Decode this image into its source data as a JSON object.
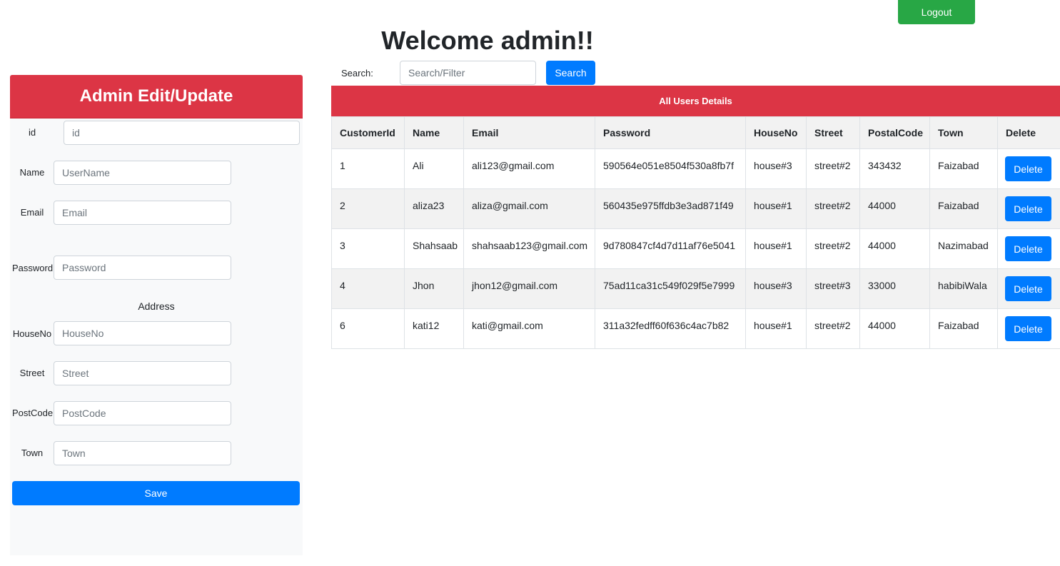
{
  "header": {
    "title": "Welcome admin!!",
    "logout_label": "Logout"
  },
  "admin_form": {
    "title": "Admin Edit/Update",
    "address_heading": "Address",
    "save_label": "Save",
    "fields": [
      {
        "label": "id",
        "placeholder": "id"
      },
      {
        "label": "Name",
        "placeholder": "UserName"
      },
      {
        "label": "Email",
        "placeholder": "Email"
      },
      {
        "label": "Password",
        "placeholder": "Password"
      },
      {
        "label": "HouseNo",
        "placeholder": "HouseNo"
      },
      {
        "label": "Street",
        "placeholder": "Street"
      },
      {
        "label": "PostCode",
        "placeholder": "PostCode"
      },
      {
        "label": "Town",
        "placeholder": "Town"
      }
    ]
  },
  "search": {
    "label": "Search:",
    "placeholder": "Search/Filter",
    "button_label": "Search"
  },
  "users_table": {
    "title": "All Users Details",
    "columns": [
      "CustomerId",
      "Name",
      "Email",
      "Password",
      "HouseNo",
      "Street",
      "PostalCode",
      "Town",
      "Delete"
    ],
    "delete_label": "Delete",
    "rows": [
      [
        "1",
        "Ali",
        "ali123@gmail.com",
        "590564e051e8504f530a8fb7f",
        "house#3",
        "street#2",
        "343432",
        "Faizabad"
      ],
      [
        "2",
        "aliza23",
        "aliza@gmail.com",
        "560435e975ffdb3e3ad871f49",
        "house#1",
        "street#2",
        "44000",
        "Faizabad"
      ],
      [
        "3",
        "Shahsaab",
        "shahsaab123@gmail.com",
        "9d780847cf4d7d11af76e5041",
        "house#1",
        "street#2",
        "44000",
        "Nazimabad"
      ],
      [
        "4",
        "Jhon",
        "jhon12@gmail.com",
        "75ad11ca31c549f029f5e7999",
        "house#3",
        "street#3",
        "33000",
        "habibiWala"
      ],
      [
        "6",
        "kati12",
        "kati@gmail.com",
        "311a32fedff60f636c4ac7b82",
        "house#1",
        "street#2",
        "44000",
        "Faizabad"
      ]
    ]
  }
}
